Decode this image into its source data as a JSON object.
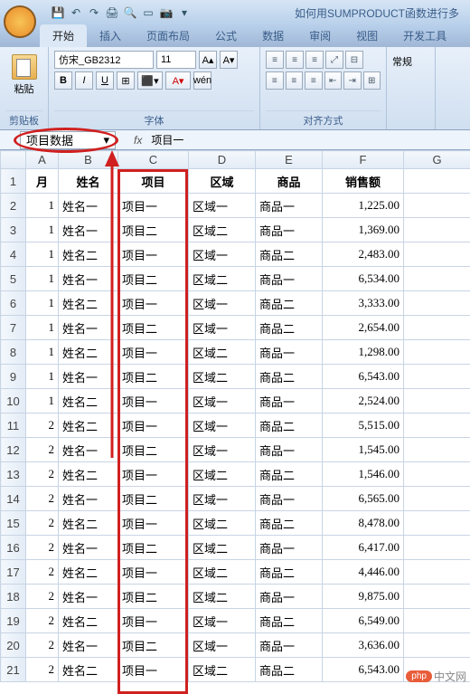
{
  "title": "如何用SUMPRODUCT函数进行多",
  "tabs": [
    "开始",
    "插入",
    "页面布局",
    "公式",
    "数据",
    "审阅",
    "视图",
    "开发工具"
  ],
  "ribbon": {
    "clipboard": {
      "paste": "粘贴",
      "label": "剪贴板"
    },
    "font": {
      "name": "仿宋_GB2312",
      "size": "11",
      "label": "字体"
    },
    "align": {
      "label": "对齐方式"
    },
    "format": {
      "label": "常规"
    }
  },
  "name_box": "项目数据",
  "formula": "项目一",
  "headers": {
    "a": "月",
    "b": "姓名",
    "c": "项目",
    "d": "区域",
    "e": "商品",
    "f": "销售额"
  },
  "rows": [
    {
      "m": "1",
      "name": "姓名一",
      "proj": "项目一",
      "reg": "区域一",
      "prod": "商品一",
      "sales": "1,225.00"
    },
    {
      "m": "1",
      "name": "姓名一",
      "proj": "项目二",
      "reg": "区域二",
      "prod": "商品一",
      "sales": "1,369.00"
    },
    {
      "m": "1",
      "name": "姓名二",
      "proj": "项目一",
      "reg": "区域一",
      "prod": "商品二",
      "sales": "2,483.00"
    },
    {
      "m": "1",
      "name": "姓名一",
      "proj": "项目二",
      "reg": "区域二",
      "prod": "商品一",
      "sales": "6,534.00"
    },
    {
      "m": "1",
      "name": "姓名二",
      "proj": "项目一",
      "reg": "区域一",
      "prod": "商品二",
      "sales": "3,333.00"
    },
    {
      "m": "1",
      "name": "姓名一",
      "proj": "项目二",
      "reg": "区域一",
      "prod": "商品二",
      "sales": "2,654.00"
    },
    {
      "m": "1",
      "name": "姓名二",
      "proj": "项目一",
      "reg": "区域二",
      "prod": "商品一",
      "sales": "1,298.00"
    },
    {
      "m": "1",
      "name": "姓名一",
      "proj": "项目二",
      "reg": "区域二",
      "prod": "商品二",
      "sales": "6,543.00"
    },
    {
      "m": "1",
      "name": "姓名二",
      "proj": "项目一",
      "reg": "区域一",
      "prod": "商品一",
      "sales": "2,524.00"
    },
    {
      "m": "2",
      "name": "姓名二",
      "proj": "项目一",
      "reg": "区域一",
      "prod": "商品二",
      "sales": "5,515.00"
    },
    {
      "m": "2",
      "name": "姓名一",
      "proj": "项目二",
      "reg": "区域一",
      "prod": "商品一",
      "sales": "1,545.00"
    },
    {
      "m": "2",
      "name": "姓名二",
      "proj": "项目一",
      "reg": "区域二",
      "prod": "商品二",
      "sales": "1,546.00"
    },
    {
      "m": "2",
      "name": "姓名一",
      "proj": "项目二",
      "reg": "区域一",
      "prod": "商品一",
      "sales": "6,565.00"
    },
    {
      "m": "2",
      "name": "姓名二",
      "proj": "项目一",
      "reg": "区域二",
      "prod": "商品二",
      "sales": "8,478.00"
    },
    {
      "m": "2",
      "name": "姓名一",
      "proj": "项目二",
      "reg": "区域二",
      "prod": "商品一",
      "sales": "6,417.00"
    },
    {
      "m": "2",
      "name": "姓名二",
      "proj": "项目一",
      "reg": "区域二",
      "prod": "商品二",
      "sales": "4,446.00"
    },
    {
      "m": "2",
      "name": "姓名一",
      "proj": "项目二",
      "reg": "区域二",
      "prod": "商品一",
      "sales": "9,875.00"
    },
    {
      "m": "2",
      "name": "姓名二",
      "proj": "项目一",
      "reg": "区域一",
      "prod": "商品二",
      "sales": "6,549.00"
    },
    {
      "m": "2",
      "name": "姓名一",
      "proj": "项目二",
      "reg": "区域一",
      "prod": "商品一",
      "sales": "3,636.00"
    },
    {
      "m": "2",
      "name": "姓名二",
      "proj": "项目一",
      "reg": "区域二",
      "prod": "商品二",
      "sales": "6,543.00"
    }
  ],
  "watermark": {
    "badge": "php",
    "text": "中文网"
  }
}
